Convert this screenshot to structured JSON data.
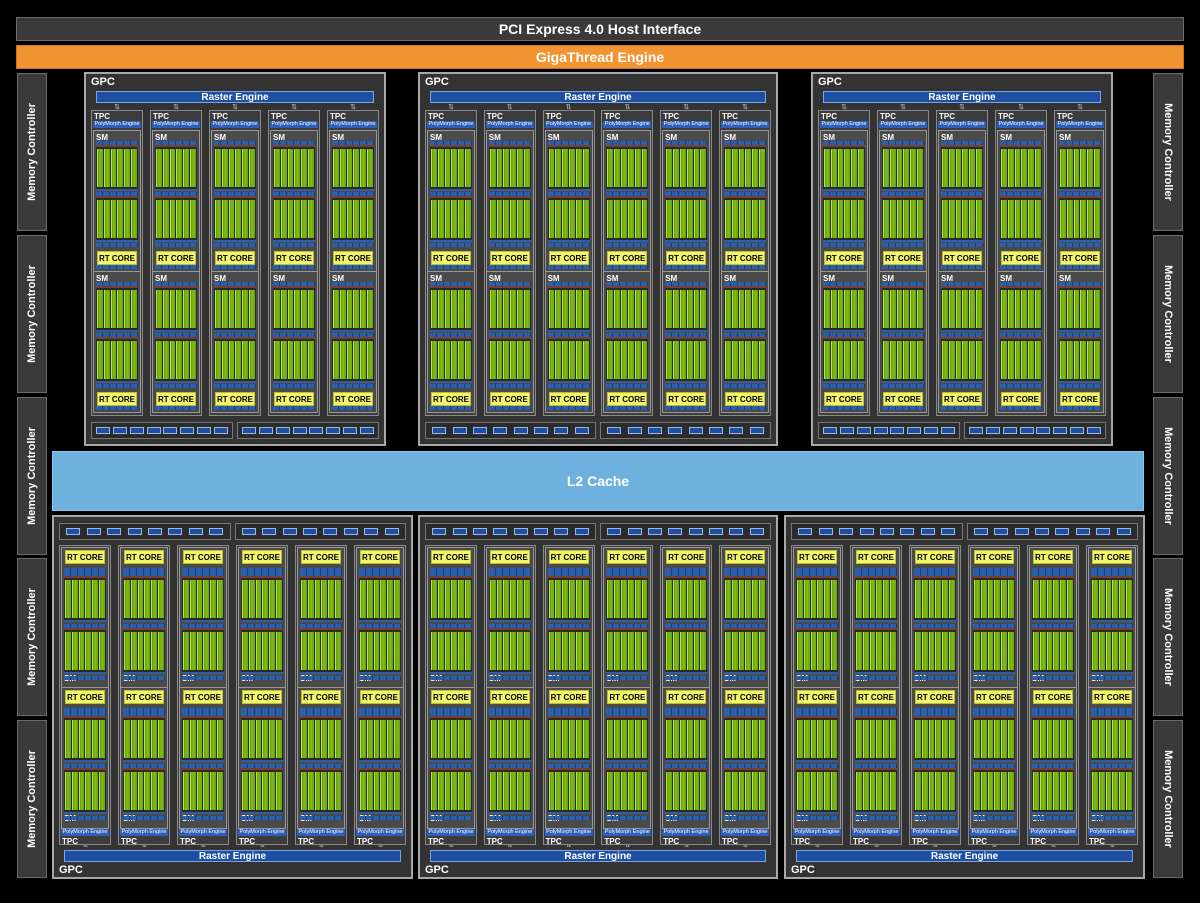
{
  "host_interface": "PCI Express 4.0 Host Interface",
  "giga_thread": "GigaThread Engine",
  "memory_controller_label": "Memory Controller",
  "memory_controllers": [
    {
      "side": "left",
      "label": "Memory Controller"
    },
    {
      "side": "left",
      "label": "Memory Controller"
    },
    {
      "side": "left",
      "label": "Memory Controller"
    },
    {
      "side": "left",
      "label": "Memory Controller"
    },
    {
      "side": "left",
      "label": "Memory Controller"
    },
    {
      "side": "right",
      "label": "Memory Controller"
    },
    {
      "side": "right",
      "label": "Memory Controller"
    },
    {
      "side": "right",
      "label": "Memory Controller"
    },
    {
      "side": "right",
      "label": "Memory Controller"
    },
    {
      "side": "right",
      "label": "Memory Controller"
    }
  ],
  "l2_cache": "L2 Cache",
  "gpc": {
    "label": "GPC",
    "raster_engine": "Raster Engine",
    "tpc_label": "TPC",
    "polymorph_engine": "PolyMorph Engine",
    "sm_label": "SM",
    "rt_core": "RT CORE",
    "tpcs_per_gpc": 6,
    "sms_per_tpc": 2
  },
  "gpcs": [
    {
      "row": "top",
      "index": 0
    },
    {
      "row": "top",
      "index": 1
    },
    {
      "row": "top",
      "index": 2
    },
    {
      "row": "bottom",
      "index": 0
    },
    {
      "row": "bottom",
      "index": 1
    },
    {
      "row": "bottom",
      "index": 2
    }
  ],
  "colors": {
    "background": "#000000",
    "giga_thread": "#f29432",
    "l2_cache": "#6eb1de",
    "raster_engine": "#1d4fa3",
    "rt_core": "#f3f56b",
    "cuda_cores": "#7fbe18"
  }
}
